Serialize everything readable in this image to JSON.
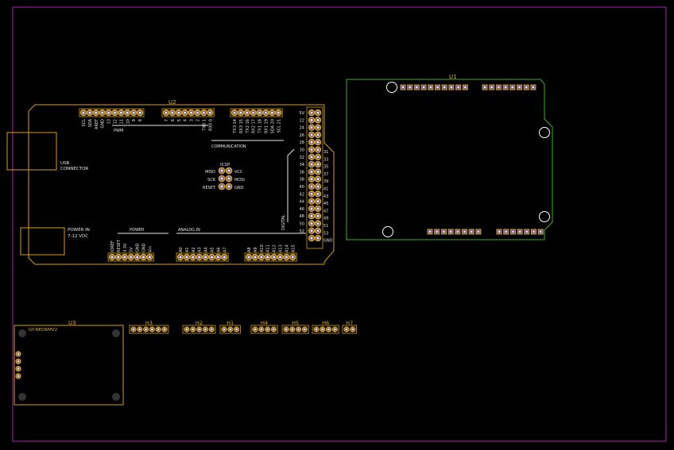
{
  "colors": {
    "background": "#000000",
    "board_outline": "#b020b0",
    "silkscreen": "#e8e8e8",
    "designator": "#e0b030",
    "component_outline": "#d4a017",
    "pad_ring": "#d4a017",
    "pad_fill": "#6b5aa8",
    "drill": "#ffffff",
    "u1_outline": "#3fae2a"
  },
  "u2": {
    "designator": "U2",
    "top_left_header": [
      "SCL",
      "SDA",
      "AREF",
      "GND",
      "13",
      "12",
      "11",
      "10",
      "9",
      "8"
    ],
    "top_mid_header": [
      "7",
      "6",
      "5",
      "4",
      "3",
      "2",
      "TX0 1",
      "RX0 0"
    ],
    "top_right_header": [
      "TX3 14",
      "RX3 15",
      "TX2 16",
      "RX2 17",
      "TX1 18",
      "RX1 19",
      "SDA 20",
      "SCL 21"
    ],
    "pwm_label": "PWM",
    "communication_label": "COMMUNICATION",
    "usb_label_1": "USB",
    "usb_label_2": "CONNECTOR",
    "power_in_label_1": "POWER IN",
    "power_in_label_2": "7-12 VDC",
    "icsp_label": "ICSP",
    "icsp_left": [
      "MISO",
      "SCK",
      "RESET"
    ],
    "icsp_right": [
      "VCC",
      "MOSI",
      "GND"
    ],
    "power_label": "POWER",
    "power_header": [
      "IOREF",
      "RESET",
      "3.3V",
      "5V",
      "GND",
      "GND",
      "Vin"
    ],
    "analog_label": "ANALOG IN",
    "analog_header_1": [
      "A0",
      "A1",
      "A2",
      "A3",
      "A4",
      "A5",
      "A6",
      "A7"
    ],
    "analog_header_2": [
      "A8",
      "A9",
      "A10",
      "A11",
      "A12",
      "A13",
      "A14",
      "A15"
    ],
    "digital_label": "DIGITAL",
    "digital_left": [
      "5V",
      "22",
      "24",
      "26",
      "28",
      "30",
      "32",
      "34",
      "36",
      "38",
      "40",
      "42",
      "44",
      "46",
      "48",
      "50",
      "52"
    ],
    "digital_right": [
      "31",
      "33",
      "35",
      "37",
      "39",
      "41",
      "43",
      "45",
      "47",
      "49",
      "51",
      "53",
      "GND"
    ]
  },
  "u1": {
    "designator": "U1"
  },
  "u3": {
    "designator": "U3",
    "part_label": "GY-NEO6MV2"
  },
  "headers": [
    {
      "designator": "H3",
      "pins": 6
    },
    {
      "designator": "H2",
      "pins": 5
    },
    {
      "designator": "H1",
      "pins": 3
    },
    {
      "designator": "H4",
      "pins": 4
    },
    {
      "designator": "H5",
      "pins": 4
    },
    {
      "designator": "H6",
      "pins": 4
    },
    {
      "designator": "H7",
      "pins": 2
    }
  ]
}
